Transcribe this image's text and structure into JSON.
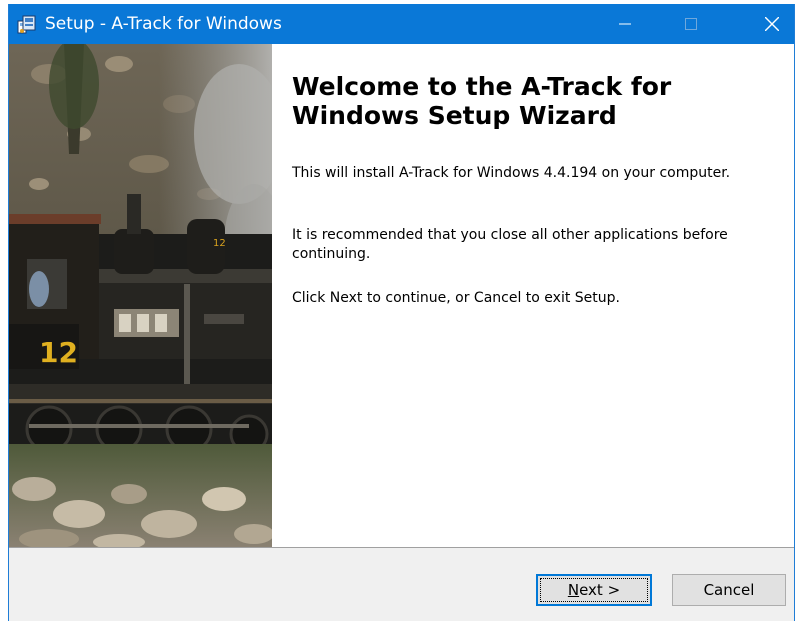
{
  "window": {
    "title": "Setup - A-Track for Windows",
    "controls": {
      "minimize_icon": "minimize-icon",
      "maximize_icon": "maximize-icon",
      "close_icon": "close-icon"
    },
    "titlebar_color": "#0a78d7"
  },
  "side_image": {
    "description_icon": "steam-locomotive-image",
    "engine_number": "12"
  },
  "content": {
    "heading": "Welcome to the A-Track for Windows Setup Wizard",
    "paragraphs": [
      "This will install A-Track for Windows 4.4.194 on your computer.",
      "It is recommended that you close all other applications before continuing.",
      "Click Next to continue, or Cancel to exit Setup."
    ]
  },
  "buttons": {
    "next_label_accel": "N",
    "next_label_rest": "ext >",
    "cancel_label": "Cancel"
  },
  "accent_color": "#0078d7"
}
